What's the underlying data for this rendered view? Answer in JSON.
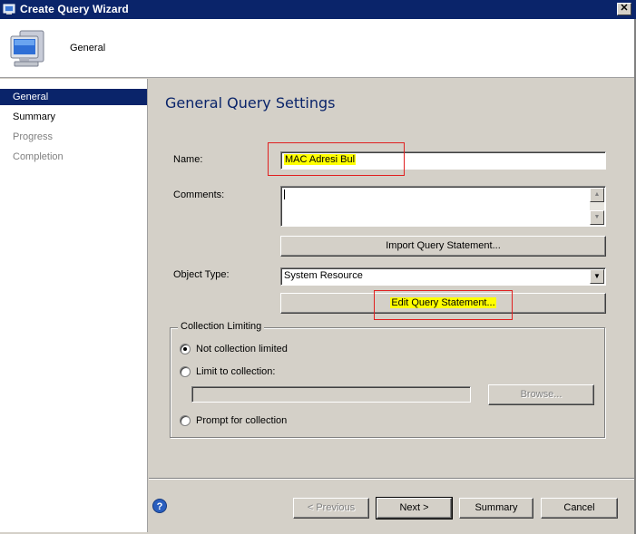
{
  "window": {
    "title": "Create Query Wizard",
    "close_glyph": "✕"
  },
  "header": {
    "title": "General",
    "icon": "computer-monitor-icon"
  },
  "sidebar": {
    "items": [
      {
        "label": "General",
        "state": "selected"
      },
      {
        "label": "Summary",
        "state": "normal"
      },
      {
        "label": "Progress",
        "state": "disabled"
      },
      {
        "label": "Completion",
        "state": "disabled"
      }
    ]
  },
  "main": {
    "section_title": "General Query Settings",
    "name_label": "Name:",
    "name_value": "MAC Adresi Bul",
    "comments_label": "Comments:",
    "comments_value": "",
    "import_button": "Import Query Statement...",
    "object_type_label": "Object Type:",
    "object_type_value": "System Resource",
    "edit_button": "Edit Query Statement...",
    "collection_limiting": {
      "legend": "Collection Limiting",
      "options": [
        {
          "label": "Not collection limited",
          "checked": true
        },
        {
          "label": "Limit to collection:",
          "checked": false
        },
        {
          "label": "Prompt for collection",
          "checked": false
        }
      ],
      "collection_value": "",
      "browse_button": "Browse..."
    }
  },
  "footer": {
    "help_glyph": "?",
    "previous_button": "< Previous",
    "next_button": "Next >",
    "summary_button": "Summary",
    "cancel_button": "Cancel"
  },
  "colors": {
    "titlebar": "#0a246a",
    "highlight": "#ffff00",
    "annotation_red": "#e02020"
  }
}
